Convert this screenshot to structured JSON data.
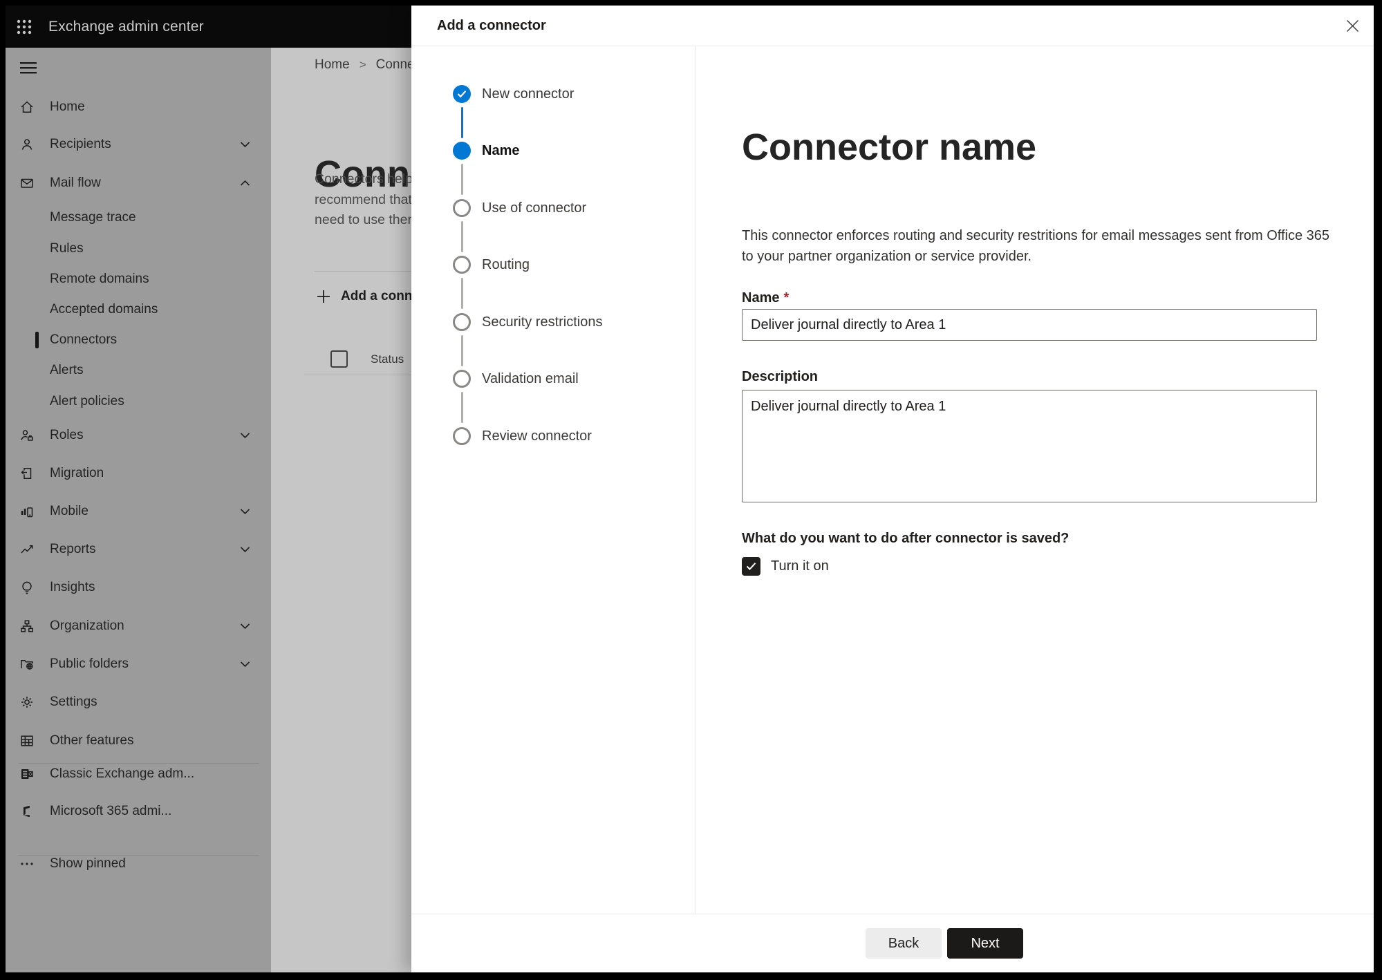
{
  "colors": {
    "accent": "#0078d4",
    "primary_button": "#1b1a19",
    "required_mark": "#a4262c"
  },
  "topbar": {
    "title": "Exchange admin center",
    "waffle_icon": "app-launcher-icon"
  },
  "sidebar": {
    "items": [
      {
        "label": "Home",
        "icon": "home-icon"
      },
      {
        "label": "Recipients",
        "icon": "person-icon",
        "chevron": "down"
      },
      {
        "label": "Mail flow",
        "icon": "mail-icon",
        "chevron": "up",
        "expanded": true
      },
      {
        "label": "Message trace",
        "indent": true
      },
      {
        "label": "Rules",
        "indent": true
      },
      {
        "label": "Remote domains",
        "indent": true
      },
      {
        "label": "Accepted domains",
        "indent": true
      },
      {
        "label": "Connectors",
        "indent": true,
        "selected": true
      },
      {
        "label": "Alerts",
        "indent": true
      },
      {
        "label": "Alert policies",
        "indent": true
      },
      {
        "label": "Roles",
        "icon": "person-badge-icon",
        "chevron": "down"
      },
      {
        "label": "Migration",
        "icon": "migration-icon"
      },
      {
        "label": "Mobile",
        "icon": "mobile-icon",
        "chevron": "down"
      },
      {
        "label": "Reports",
        "icon": "line-chart-icon",
        "chevron": "down"
      },
      {
        "label": "Insights",
        "icon": "lightbulb-icon"
      },
      {
        "label": "Organization",
        "icon": "org-chart-icon",
        "chevron": "down"
      },
      {
        "label": "Public folders",
        "icon": "folder-globe-icon",
        "chevron": "down"
      },
      {
        "label": "Settings",
        "icon": "gear-icon"
      },
      {
        "label": "Other features",
        "icon": "table-grid-icon"
      },
      {
        "label": "Classic Exchange adm...",
        "icon": "exchange-logo-icon"
      },
      {
        "label": "Microsoft 365 admi...",
        "icon": "microsoft365-logo-icon"
      },
      {
        "label": "Show pinned",
        "icon": "ellipsis-icon"
      }
    ]
  },
  "page_background": {
    "breadcrumb_home": "Home",
    "breadcrumb_separator": ">",
    "breadcrumb_current": "Conne",
    "title": "Connect",
    "intro_line1": "Connectors help",
    "intro_line2": "recommend that",
    "intro_line3": "need to use ther",
    "add_button_label": "Add a conn",
    "table_header_status": "Status"
  },
  "dialog": {
    "title": "Add a connector",
    "close_icon": "close-icon",
    "wizard_steps": [
      {
        "label": "New connector",
        "state": "completed"
      },
      {
        "label": "Name",
        "state": "current"
      },
      {
        "label": "Use of connector",
        "state": "upcoming"
      },
      {
        "label": "Routing",
        "state": "upcoming"
      },
      {
        "label": "Security restrictions",
        "state": "upcoming"
      },
      {
        "label": "Validation email",
        "state": "upcoming"
      },
      {
        "label": "Review connector",
        "state": "upcoming"
      }
    ],
    "heading": "Connector name",
    "description_line1": "This connector enforces routing and security restritions for email messages sent from Office 365",
    "description_line2": "to your partner organization or service provider.",
    "name_label": "Name",
    "required_mark": "*",
    "name_value": "Deliver journal directly to Area 1",
    "description_label": "Description",
    "description_value": "Deliver journal directly to Area 1",
    "after_save_question": "What do you want to do after connector is saved?",
    "turn_on_label": "Turn it on",
    "turn_on_checked": true,
    "back_label": "Back",
    "next_label": "Next"
  }
}
